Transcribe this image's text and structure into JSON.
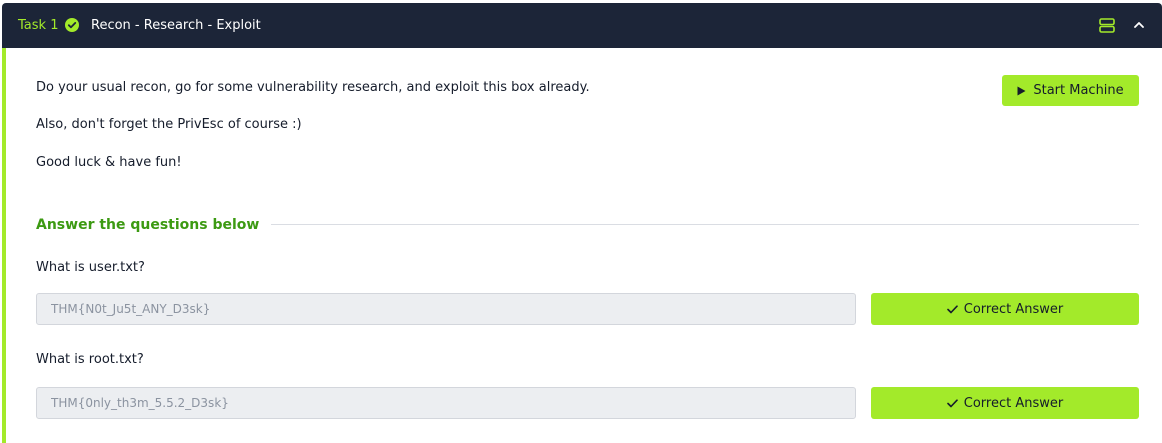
{
  "task": {
    "label": "Task 1",
    "title": "Recon - Research - Exploit",
    "status_icon": "check-circle-icon"
  },
  "header_icons": [
    "split-view-icon",
    "chevron-up-icon"
  ],
  "description": [
    "Do your usual recon, go for some vulnerability research, and exploit this box already.",
    "Also, don't forget the PrivEsc of course :)",
    "Good luck & have fun!"
  ],
  "start_button": {
    "label": "Start Machine",
    "icon": "play-icon"
  },
  "section_heading": "Answer the questions below",
  "questions": [
    {
      "prompt": "What is user.txt?",
      "answer": "THM{N0t_Ju5t_ANY_D3sk}",
      "button_label": "Correct Answer"
    },
    {
      "prompt": "What is root.txt?",
      "answer": "THM{0nly_th3m_5.5.2_D3sk}",
      "button_label": "Correct Answer"
    }
  ],
  "colors": {
    "header_bg": "#1c2538",
    "accent": "#a3ea2a",
    "heading_green": "#3c9a12",
    "text": "#151c2b",
    "input_bg": "#eceef1"
  }
}
